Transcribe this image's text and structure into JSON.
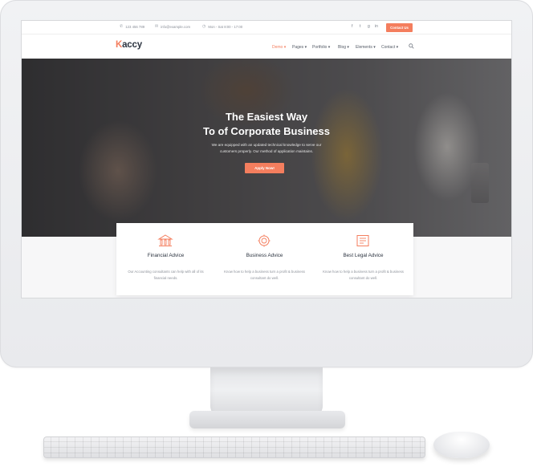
{
  "topbar": {
    "phone": "123 456 789",
    "email": "info@example.com",
    "hours": "Mon - Sat 8:00 - 17:00",
    "social": [
      "f",
      "t",
      "g",
      "in"
    ],
    "contact_button": "Contact Us"
  },
  "navbar": {
    "logo_initial": "K",
    "logo_rest": "accy",
    "menu": [
      {
        "label": "Demo ▾",
        "active": true
      },
      {
        "label": "Pages ▾",
        "active": false
      },
      {
        "label": "Portfolio ▾",
        "active": false
      },
      {
        "label": "Blog ▾",
        "active": false
      },
      {
        "label": "Elements ▾",
        "active": false
      },
      {
        "label": "Contact ▾",
        "active": false
      }
    ],
    "search_icon": "search-icon"
  },
  "hero": {
    "title_line1": "The Easiest Way",
    "title_line2": "To of Corporate Business",
    "desc_line1": "We are equipped with an updated technical knowledge to serve our",
    "desc_line2": "customers properly. Our method of application maintains.",
    "button": "Apply Now!"
  },
  "features": [
    {
      "icon": "bank-icon",
      "title": "Financial Advice",
      "desc": "Our Accounting consultants can help with all of its financial needs."
    },
    {
      "icon": "gear-chart-icon",
      "title": "Business Advice",
      "desc": "Know how to help a business turn a profit & business consultant do well."
    },
    {
      "icon": "legal-document-icon",
      "title": "Best Legal Advice",
      "desc": "Know how to help a business turn a profit & business consultant do well."
    }
  ],
  "colors": {
    "accent": "#f47e5e",
    "text_dark": "#2c3440",
    "text_muted": "#8d929a"
  }
}
